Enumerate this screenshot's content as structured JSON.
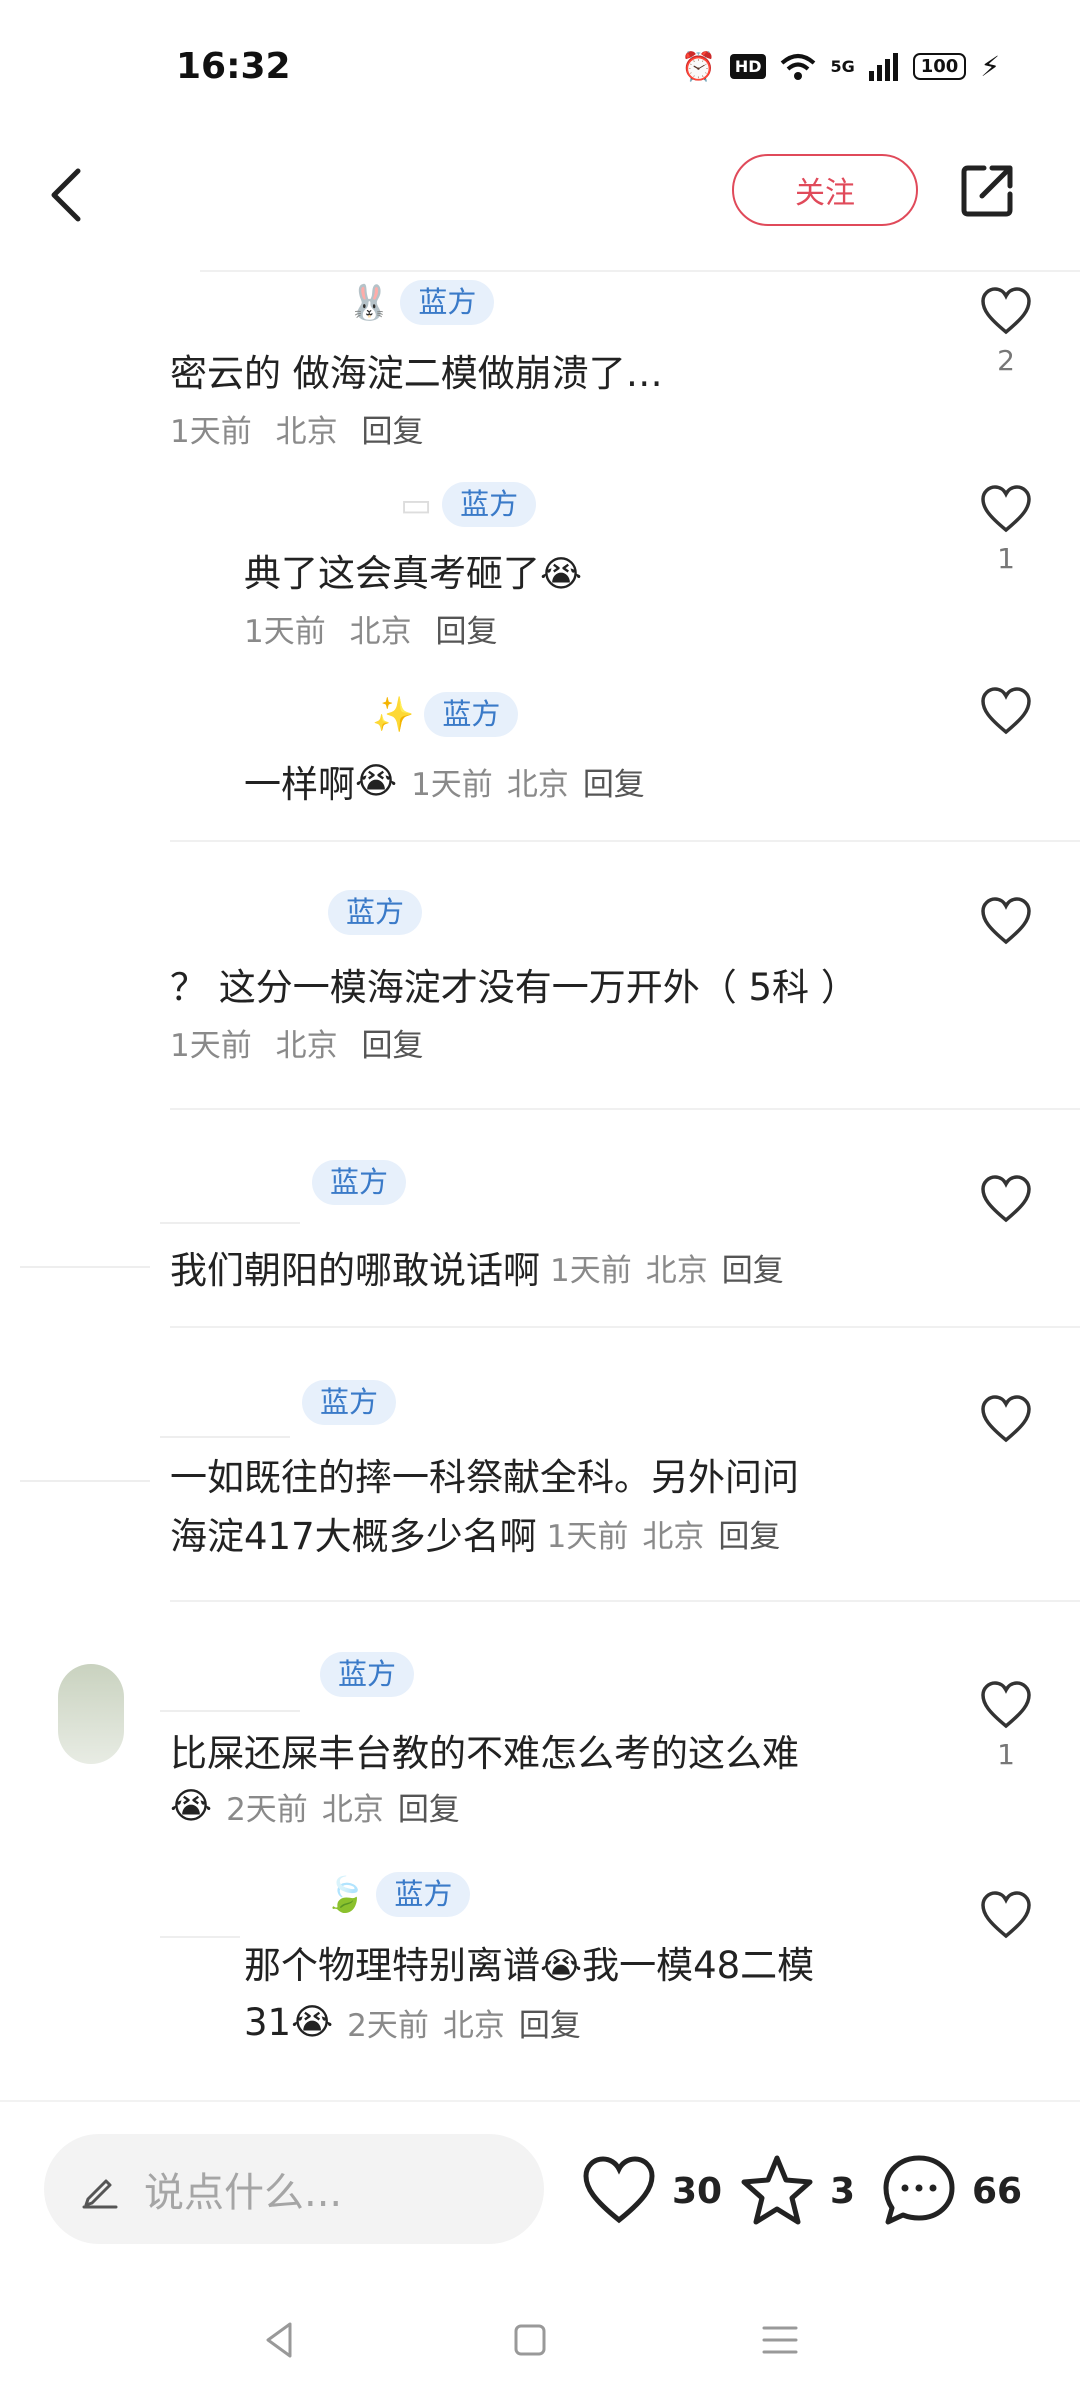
{
  "status": {
    "time": "16:32",
    "hd": "HD",
    "network": "5G",
    "battery": "100"
  },
  "header": {
    "follow_label": "关注"
  },
  "comments": [
    {
      "tag": "蓝方",
      "text": "密云的 做海淀二模做崩溃了…",
      "time": "1天前",
      "location": "北京",
      "reply": "回复",
      "likes": "2"
    },
    {
      "tag": "蓝方",
      "text": "典了这会真考砸了",
      "emoji": "😭",
      "time": "1天前",
      "location": "北京",
      "reply": "回复",
      "likes": "1"
    },
    {
      "tag": "蓝方",
      "text": "一样啊",
      "emoji": "😭",
      "time": "1天前",
      "location": "北京",
      "reply": "回复",
      "likes": ""
    },
    {
      "tag": "蓝方",
      "text": "？ 这分一模海淀才没有一万开外（ 5科 ）",
      "time": "1天前",
      "location": "北京",
      "reply": "回复",
      "likes": ""
    },
    {
      "tag": "蓝方",
      "text": "我们朝阳的哪敢说话啊",
      "time": "1天前",
      "location": "北京",
      "reply": "回复",
      "likes": ""
    },
    {
      "tag": "蓝方",
      "text_line1": "一如既往的摔一科祭献全科。另外问问",
      "text_line2": "海淀417大概多少名啊",
      "time": "1天前",
      "location": "北京",
      "reply": "回复",
      "likes": ""
    },
    {
      "tag": "蓝方",
      "text": "比屎还屎丰台教的不难怎么考的这么难",
      "emoji": "😭",
      "time": "2天前",
      "location": "北京",
      "reply": "回复",
      "likes": "1"
    },
    {
      "tag": "蓝方",
      "text_line1a": "那个物理特别离谱",
      "text_line1b": "我一模48二模",
      "text_line2": "31",
      "emoji": "😭",
      "time": "2天前",
      "location": "北京",
      "reply": "回复",
      "likes": ""
    }
  ],
  "bottom": {
    "placeholder": "说点什么...",
    "like_count": "30",
    "star_count": "3",
    "comment_count": "66"
  },
  "icons": {
    "back": "back-arrow-icon",
    "share": "share-icon",
    "heart": "heart-icon",
    "star": "star-icon",
    "comment": "comment-bubble-icon",
    "pen": "pen-icon"
  },
  "colors": {
    "accent": "#e04a5a",
    "tag_bg": "#e7f0fb",
    "tag_text": "#3a7ac8"
  }
}
